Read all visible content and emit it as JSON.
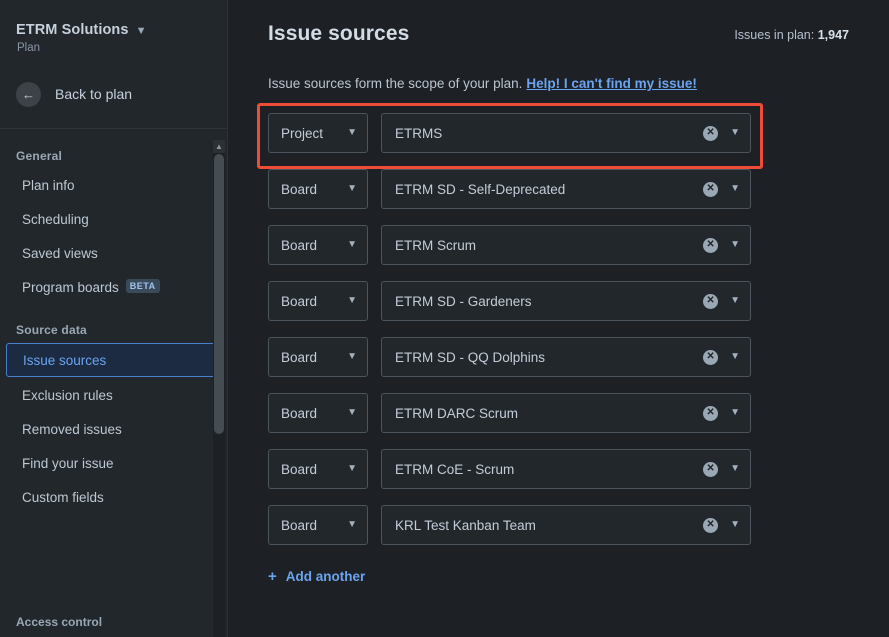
{
  "sidebar": {
    "project_name": "ETRM Solutions",
    "project_sub": "Plan",
    "back_label": "Back to plan",
    "back_icon": "arrow-left-icon",
    "chevron_icon": "chevron-down-icon",
    "sections": [
      {
        "title": "General",
        "items": [
          {
            "label": "Plan info",
            "selected": false
          },
          {
            "label": "Scheduling",
            "selected": false
          },
          {
            "label": "Saved views",
            "selected": false
          },
          {
            "label": "Program boards",
            "badge": "BETA",
            "selected": false
          }
        ]
      },
      {
        "title": "Source data",
        "items": [
          {
            "label": "Issue sources",
            "selected": true
          },
          {
            "label": "Exclusion rules",
            "selected": false
          },
          {
            "label": "Removed issues",
            "selected": false
          },
          {
            "label": "Find your issue",
            "selected": false
          },
          {
            "label": "Custom fields",
            "selected": false
          }
        ]
      }
    ],
    "bottom_section": "Access control"
  },
  "main": {
    "title": "Issue sources",
    "issues_in_plan_label": "Issues in plan:",
    "issues_in_plan_value": "1,947",
    "subtitle": "Issue sources form the scope of your plan.",
    "help_link": "Help! I can't find my issue!",
    "add_another": "Add another",
    "add_icon": "plus-icon",
    "clear_icon": "clear-circle-icon",
    "dropdown_icon": "chevron-down-icon",
    "rows": [
      {
        "type": "Project",
        "value": "ETRMS",
        "highlighted": true
      },
      {
        "type": "Board",
        "value": "ETRM SD - Self-Deprecated",
        "highlighted": false
      },
      {
        "type": "Board",
        "value": "ETRM Scrum",
        "highlighted": false
      },
      {
        "type": "Board",
        "value": "ETRM SD - Gardeners",
        "highlighted": false
      },
      {
        "type": "Board",
        "value": "ETRM SD - QQ Dolphins",
        "highlighted": false
      },
      {
        "type": "Board",
        "value": "ETRM DARC Scrum",
        "highlighted": false
      },
      {
        "type": "Board",
        "value": "ETRM CoE - Scrum",
        "highlighted": false
      },
      {
        "type": "Board",
        "value": "KRL Test Kanban Team",
        "highlighted": false
      }
    ]
  },
  "colors": {
    "accent_blue": "#6aa4f0",
    "highlight_red": "#ef4b39",
    "panel_bg": "#1d2125",
    "sidebar_bg": "#22272b"
  }
}
